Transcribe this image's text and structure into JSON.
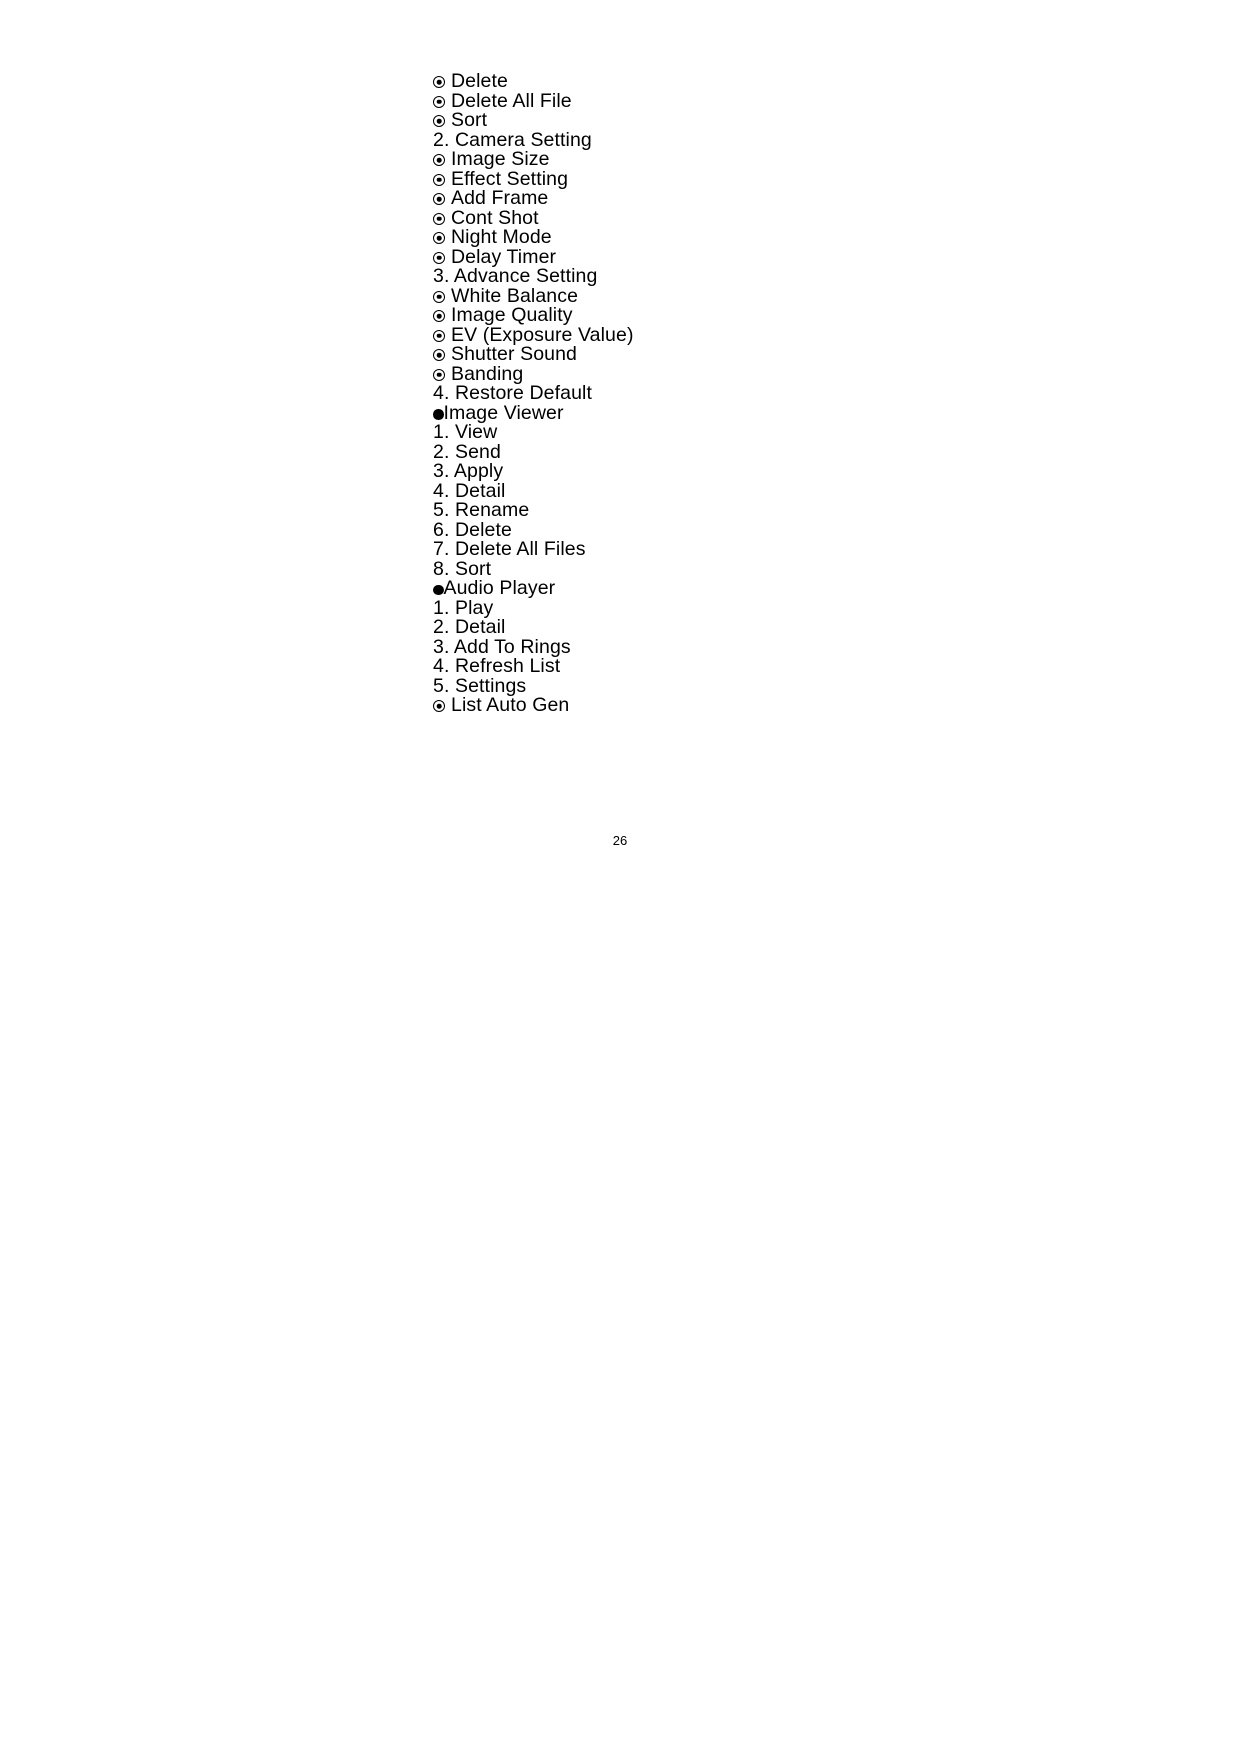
{
  "document": {
    "page_number": "26",
    "lines": [
      {
        "marker": "ring",
        "text": "Delete"
      },
      {
        "marker": "ring",
        "text": "Delete All File"
      },
      {
        "marker": "ring",
        "text": "Sort"
      },
      {
        "marker": "num",
        "text": "2. Camera Setting"
      },
      {
        "marker": "ring",
        "text": "Image Size"
      },
      {
        "marker": "ring",
        "text": "Effect Setting"
      },
      {
        "marker": "ring",
        "text": "Add Frame"
      },
      {
        "marker": "ring",
        "text": "Cont Shot"
      },
      {
        "marker": "ring",
        "text": "Night Mode"
      },
      {
        "marker": "ring",
        "text": "Delay Timer"
      },
      {
        "marker": "num",
        "text": "3. Advance Setting"
      },
      {
        "marker": "ring",
        "text": "White Balance"
      },
      {
        "marker": "ring",
        "text": "Image Quality"
      },
      {
        "marker": "ring",
        "text": "EV (Exposure Value)"
      },
      {
        "marker": "ring",
        "text": "Shutter Sound"
      },
      {
        "marker": "ring",
        "text": "Banding"
      },
      {
        "marker": "num",
        "text": "4. Restore Default"
      },
      {
        "marker": "solid",
        "text": "Image Viewer"
      },
      {
        "marker": "num",
        "text": "1. View"
      },
      {
        "marker": "num",
        "text": "2. Send"
      },
      {
        "marker": "num",
        "text": "3. Apply"
      },
      {
        "marker": "num",
        "text": "4. Detail"
      },
      {
        "marker": "num",
        "text": "5. Rename"
      },
      {
        "marker": "num",
        "text": "6. Delete"
      },
      {
        "marker": "num",
        "text": "7. Delete All Files"
      },
      {
        "marker": "num",
        "text": "8. Sort"
      },
      {
        "marker": "solid",
        "text": "Audio Player"
      },
      {
        "marker": "num",
        "text": "1. Play"
      },
      {
        "marker": "num",
        "text": "2. Detail"
      },
      {
        "marker": "num",
        "text": "3. Add To Rings"
      },
      {
        "marker": "num",
        "text": "4. Refresh List"
      },
      {
        "marker": "num",
        "text": "5. Settings"
      },
      {
        "marker": "ring",
        "text": "List Auto Gen"
      }
    ]
  },
  "colors": {
    "page_background": "#ffffff",
    "text": "#000000"
  }
}
